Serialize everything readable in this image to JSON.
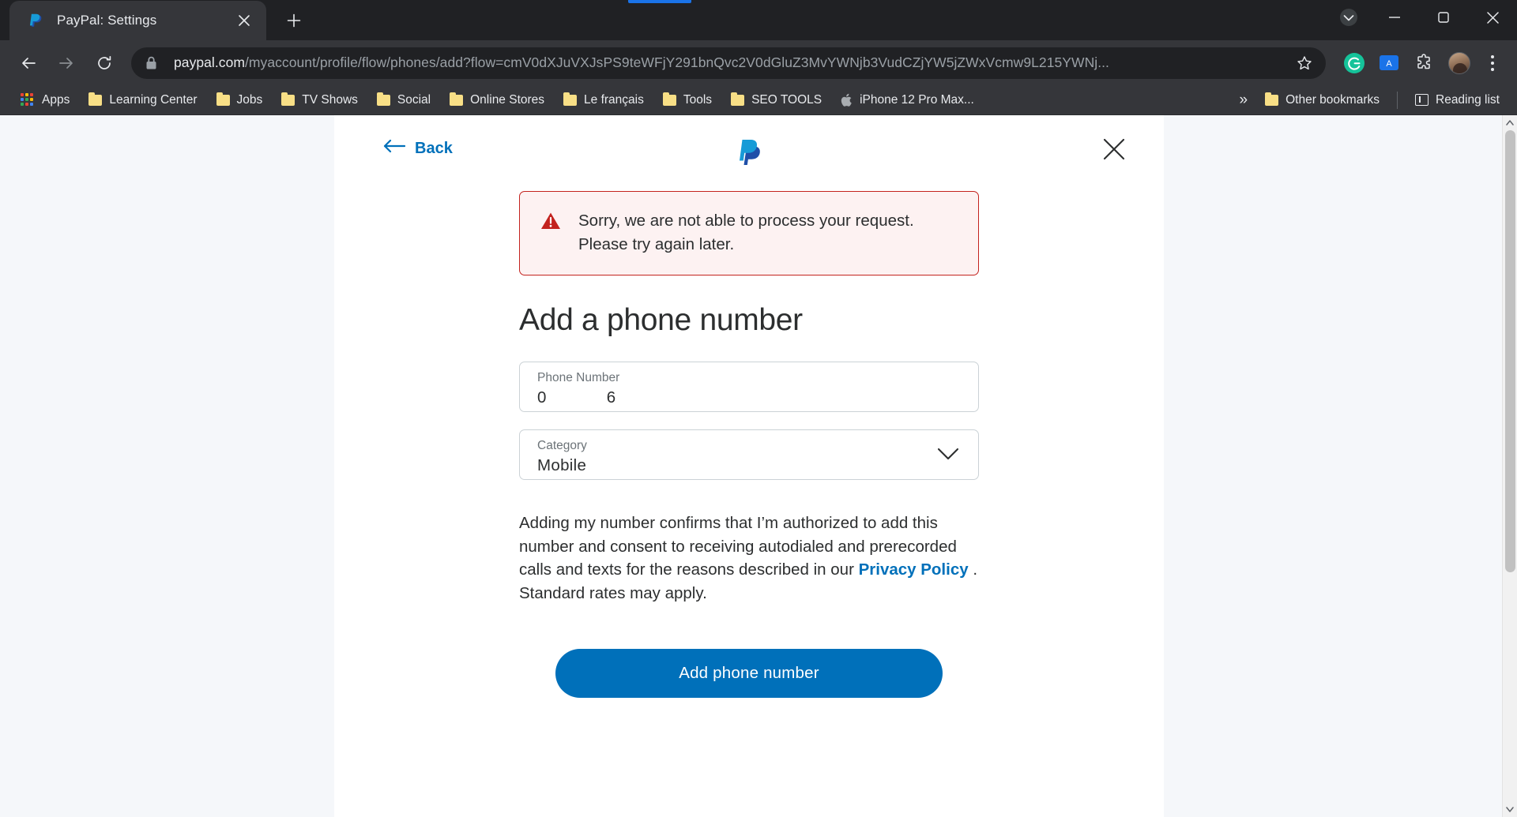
{
  "browser": {
    "tab": {
      "title": "PayPal: Settings",
      "favicon": "paypal-logo-icon",
      "close": "close-tab-icon"
    },
    "new_tab_label": "+",
    "window_controls": {
      "minimize": "–",
      "maximize": "▢",
      "close": "✕",
      "profile": "profile-avatar-icon"
    },
    "nav": {
      "back": "back-arrow-icon",
      "forward": "forward-arrow-icon",
      "reload": "reload-icon"
    },
    "omnibox": {
      "lock": "lock-icon",
      "domain": "paypal.com",
      "path": "/myaccount/profile/flow/phones/add?flow=cmV0dXJuVXJsPS9teWFjY291bnQvc2V0dGluZ3MvYWNjb3VudCZjYW5jZWxVcmw9L215YWNj...",
      "star": "bookmark-star-icon"
    },
    "toolbar_icons": [
      "grammarly-icon",
      "translate-icon",
      "extensions-puzzle-icon",
      "profile-avatar-icon",
      "chrome-menu-icon"
    ],
    "bookmarks": [
      {
        "label": "Apps",
        "icon": "apps-grid-icon"
      },
      {
        "label": "Learning Center",
        "icon": "folder-icon"
      },
      {
        "label": "Jobs",
        "icon": "folder-icon"
      },
      {
        "label": "TV Shows",
        "icon": "folder-icon"
      },
      {
        "label": "Social",
        "icon": "folder-icon"
      },
      {
        "label": "Online Stores",
        "icon": "folder-icon"
      },
      {
        "label": "Le français",
        "icon": "folder-icon"
      },
      {
        "label": "Tools",
        "icon": "folder-icon"
      },
      {
        "label": "SEO TOOLS",
        "icon": "folder-icon"
      },
      {
        "label": "iPhone 12 Pro Max...",
        "icon": "apple-icon"
      }
    ],
    "bookmarks_overflow": "»",
    "other_bookmarks": {
      "label": "Other bookmarks",
      "icon": "folder-icon"
    },
    "reading_list": {
      "label": "Reading list",
      "icon": "reading-list-icon"
    }
  },
  "page": {
    "back_label": "Back",
    "logo": "paypal-logo-icon",
    "close": "close-dialog-icon",
    "alert": {
      "icon": "error-warning-icon",
      "line1": "Sorry, we are not able to process your request.",
      "line2": "Please try again later."
    },
    "title": "Add a phone number",
    "phone_field": {
      "label": "Phone Number",
      "value_prefix": "0",
      "value_suffix": "6"
    },
    "category_field": {
      "label": "Category",
      "value": "Mobile",
      "chevron": "chevron-down-icon"
    },
    "consent": {
      "text_before": "Adding my number confirms that I’m authorized to add this number and consent to receiving autodialed and prerecorded calls and texts for the reasons described in our ",
      "link": "Privacy Policy",
      "text_after": " . Standard rates may apply."
    },
    "submit_label": "Add phone number"
  },
  "colors": {
    "paypal_blue": "#0070BA",
    "error_red": "#C3221E",
    "error_bg": "#FDF2F2",
    "chrome_dark": "#202124",
    "chrome_toolbar": "#35363A"
  }
}
